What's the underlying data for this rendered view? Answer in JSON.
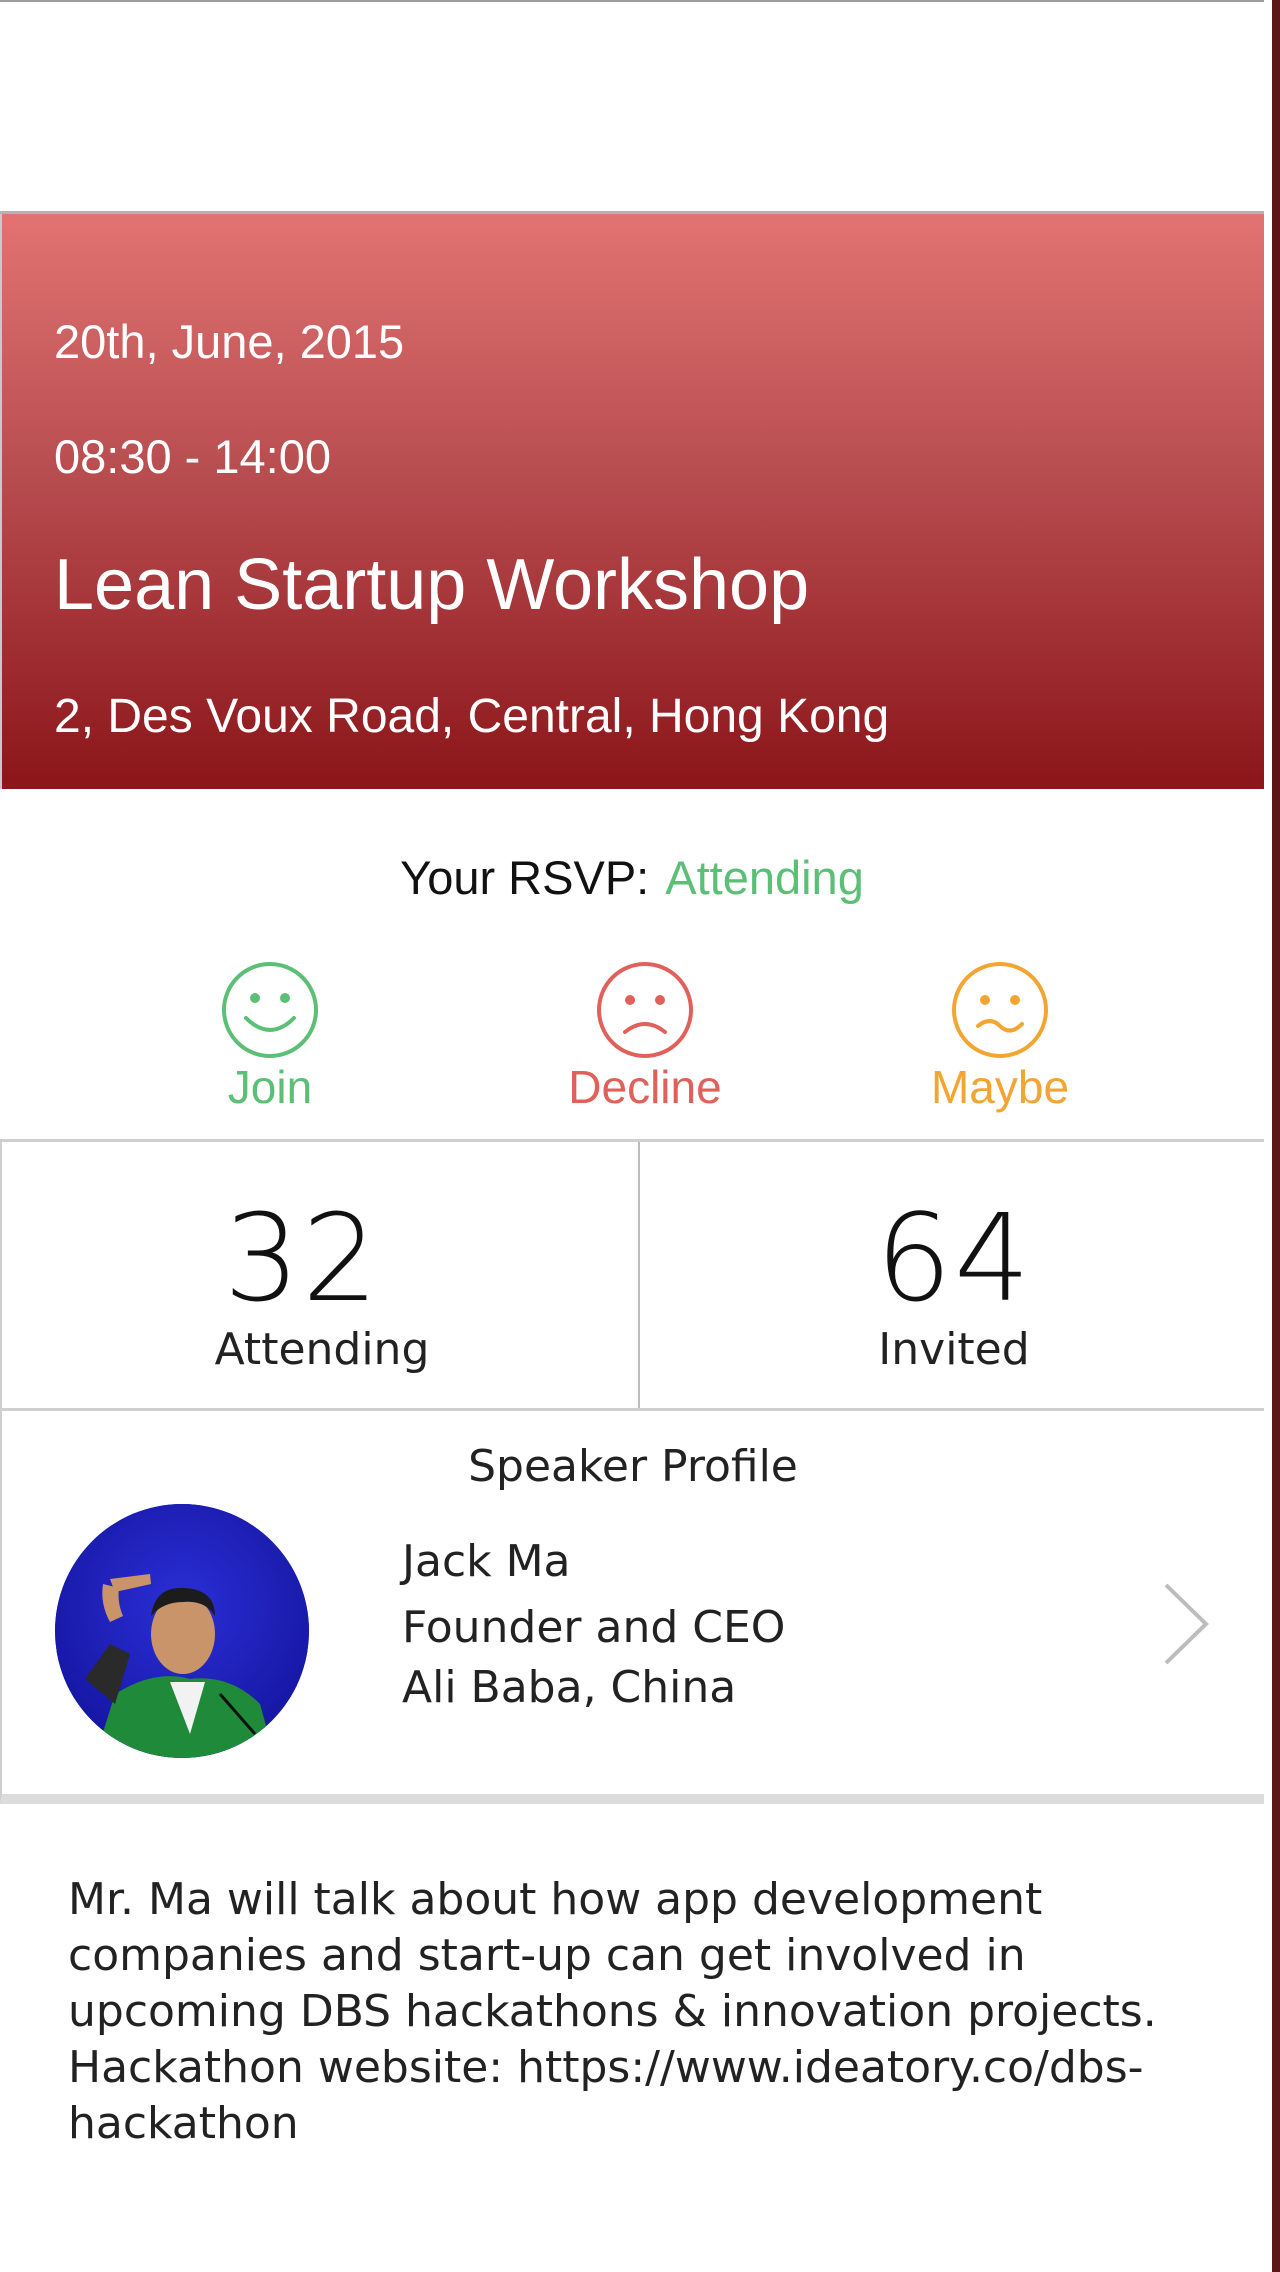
{
  "event": {
    "date": "20th, June, 2015",
    "time": "08:30 - 14:00",
    "title": "Lean Startup Workshop",
    "address": "2, Des Voux Road, Central, Hong Kong"
  },
  "rsvp": {
    "label": "Your RSVP:",
    "status": "Attending",
    "options": [
      {
        "label": "Join",
        "icon": "happy-face-icon",
        "color": "#5bbf75"
      },
      {
        "label": "Decline",
        "icon": "sad-face-icon",
        "color": "#e0605a"
      },
      {
        "label": "Maybe",
        "icon": "unsure-face-icon",
        "color": "#f2a531"
      }
    ]
  },
  "stats": {
    "attending": {
      "value": "32",
      "label": "Attending"
    },
    "invited": {
      "value": "64",
      "label": "Invited"
    }
  },
  "speaker": {
    "header": "Speaker Profile",
    "name": "Jack Ma",
    "role": "Founder and CEO",
    "company": "Ali Baba, China",
    "chevron": "chevron-right-icon"
  },
  "description": "Mr. Ma will talk about how app development companies and start-up can get involved in upcoming DBS hackathons & innovation projects. Hackathon website: https://www.ideatory.co/dbs-hackathon",
  "colors": {
    "hero_top": "#e27372",
    "hero_bottom": "#8b1519",
    "attending_green": "#5bbf75",
    "side_strip": "#5c1519"
  }
}
